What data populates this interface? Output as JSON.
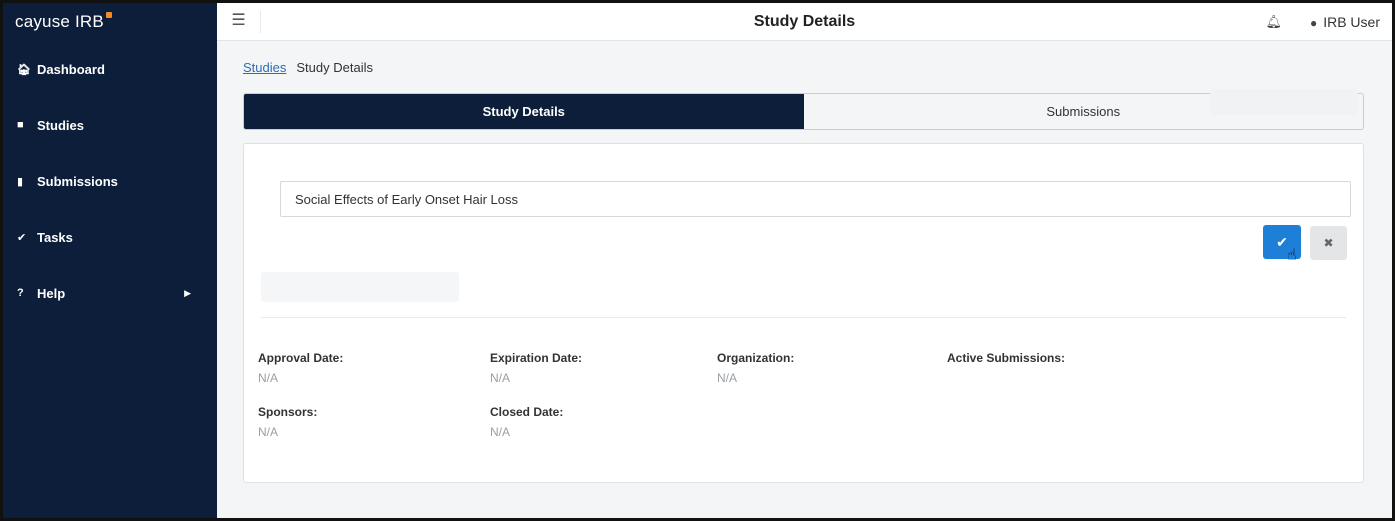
{
  "app": {
    "brand": "cayuse IRB",
    "accent_color": "#f28c28",
    "nav_color": "#0c1e3a"
  },
  "sidebar": {
    "items": [
      {
        "label": "Dashboard",
        "icon": "home-icon"
      },
      {
        "label": "Studies",
        "icon": "folder-icon"
      },
      {
        "label": "Submissions",
        "icon": "file-icon"
      },
      {
        "label": "Tasks",
        "icon": "check-icon"
      },
      {
        "label": "Help",
        "icon": "question-icon"
      }
    ]
  },
  "topbar": {
    "title": "Study Details",
    "user": "IRB User"
  },
  "breadcrumb": {
    "link": "Studies",
    "current": "Study Details"
  },
  "tabs": [
    {
      "label": "Study Details",
      "active": true
    },
    {
      "label": "Submissions",
      "active": false
    }
  ],
  "study": {
    "title_value": "Social Effects of Early Onset Hair Loss"
  },
  "fields": {
    "approval_date": {
      "label": "Approval Date:",
      "value": "N/A"
    },
    "expiration_date": {
      "label": "Expiration Date:",
      "value": "N/A"
    },
    "organization": {
      "label": "Organization:",
      "value": "N/A"
    },
    "active_submissions": {
      "label": "Active Submissions:",
      "value": ""
    },
    "sponsors": {
      "label": "Sponsors:",
      "value": "N/A"
    },
    "closed_date": {
      "label": "Closed Date:",
      "value": "N/A"
    }
  }
}
